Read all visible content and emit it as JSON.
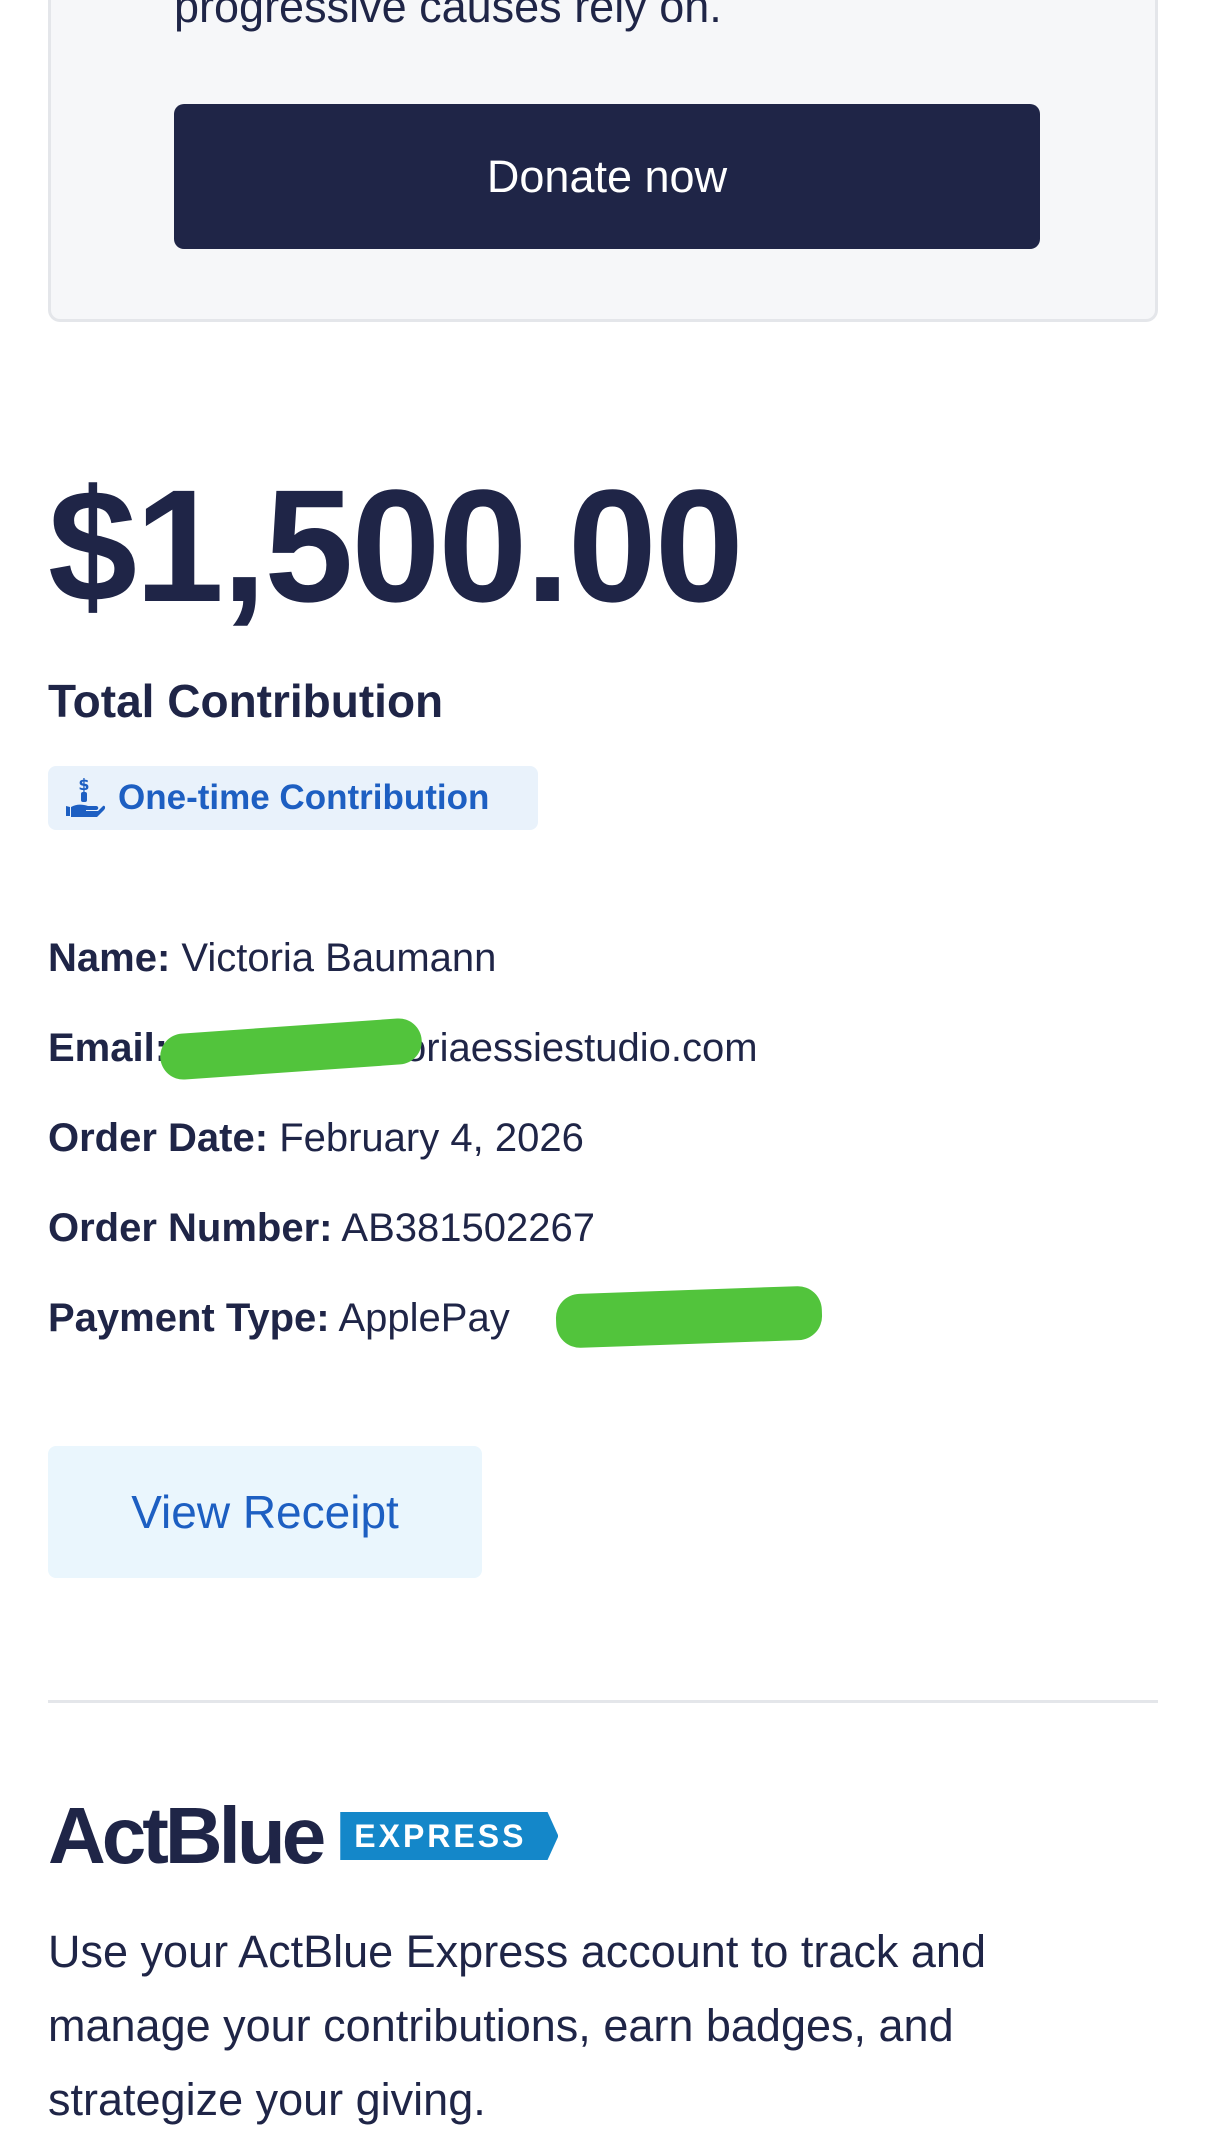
{
  "promo": {
    "text": "progressive causes rely on.",
    "donate_label": "Donate now"
  },
  "summary": {
    "amount": "$1,500.00",
    "total_label": "Total Contribution",
    "badge_label": "One-time Contribution"
  },
  "details": {
    "name_key": "Name:",
    "name_value": "Victoria Baumann",
    "email_key": "Email:",
    "email_value": "oriaessiestudio.com",
    "date_key": "Order Date:",
    "date_value": "February 4, 2026",
    "number_key": "Order Number:",
    "number_value": "AB381502267",
    "payment_key": "Payment Type:",
    "payment_value": "ApplePay"
  },
  "actions": {
    "receipt_label": "View Receipt"
  },
  "express": {
    "logo_word": "ActBlue",
    "logo_tag": "EXPRESS",
    "description": "Use your ActBlue Express account to track and manage your contributions, earn badges, and strategize your giving."
  },
  "colors": {
    "navy": "#1f2547",
    "link_blue": "#1d5fc2",
    "badge_bg": "#e9f2fb",
    "receipt_bg": "#eaf6fd",
    "express_blue": "#1487c9",
    "redaction_green": "#52c43c"
  },
  "icons": {
    "badge_icon": "hand-dollar-icon"
  }
}
